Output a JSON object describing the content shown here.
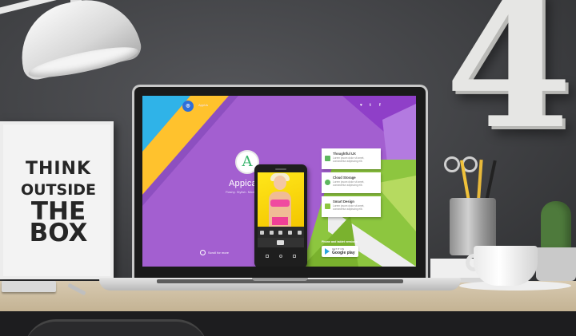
{
  "poster": {
    "line1": "THINK",
    "line2": "OUTSIDE",
    "line3": "THE",
    "line4": "BOX"
  },
  "wall_number": "4",
  "site": {
    "logo_letter": "◎",
    "nav_brand": "AppUs",
    "social": [
      "♥",
      "t",
      "f"
    ],
    "hero_letter": "A",
    "hero_title": "Appica",
    "hero_subtitle": "Flashy. Stylish. Modern.",
    "scroll_hint": "Scroll for more",
    "features": [
      {
        "title": "Thoughtful UX",
        "desc": "Lorem ipsum dolor sit amet, consectetur adipiscing elit."
      },
      {
        "title": "Cloud Storage",
        "desc": "Lorem ipsum dolor sit amet, consectetur adipiscing elit."
      },
      {
        "title": "Smart Design",
        "desc": "Lorem ipsum dolor sit amet, consectetur adipiscing elit."
      }
    ],
    "download_label": "Phone and tablet versions",
    "store_small": "GET IT ON",
    "store_big": "Google play"
  },
  "colors": {
    "purple": "#a35fd0",
    "blue": "#2fb3e8",
    "yellow": "#ffc22d",
    "green": "#8dc63f",
    "lightgreen": "#b6da60"
  }
}
